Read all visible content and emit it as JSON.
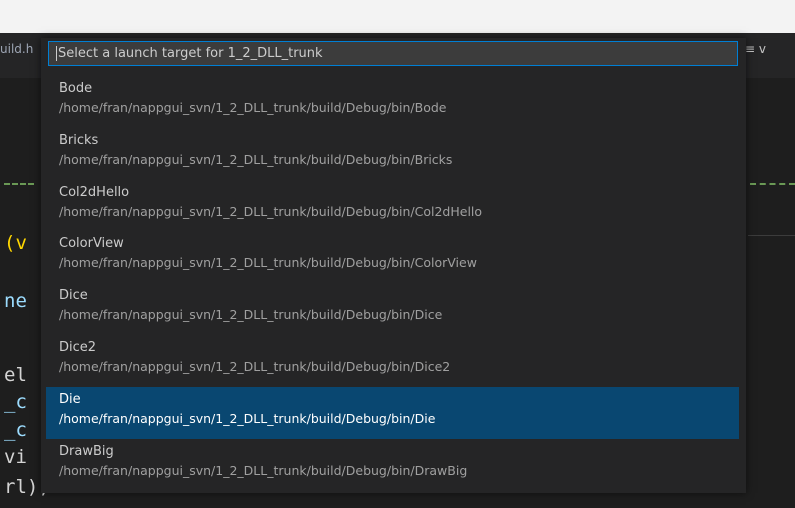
{
  "tabs": {
    "left_fragment": "uild.h",
    "right_fragment": "≡ v"
  },
  "code_fragments": [
    "(v",
    "ne",
    "el",
    "_c",
    "_c",
    "vi",
    "rl);"
  ],
  "quick_pick": {
    "placeholder": "Select a launch target for 1_2_DLL_trunk",
    "items": [
      {
        "label": "Bode",
        "description": "/home/fran/nappgui_svn/1_2_DLL_trunk/build/Debug/bin/Bode"
      },
      {
        "label": "Bricks",
        "description": "/home/fran/nappgui_svn/1_2_DLL_trunk/build/Debug/bin/Bricks"
      },
      {
        "label": "Col2dHello",
        "description": "/home/fran/nappgui_svn/1_2_DLL_trunk/build/Debug/bin/Col2dHello"
      },
      {
        "label": "ColorView",
        "description": "/home/fran/nappgui_svn/1_2_DLL_trunk/build/Debug/bin/ColorView"
      },
      {
        "label": "Dice",
        "description": "/home/fran/nappgui_svn/1_2_DLL_trunk/build/Debug/bin/Dice"
      },
      {
        "label": "Dice2",
        "description": "/home/fran/nappgui_svn/1_2_DLL_trunk/build/Debug/bin/Dice2"
      },
      {
        "label": "Die",
        "description": "/home/fran/nappgui_svn/1_2_DLL_trunk/build/Debug/bin/Die",
        "selected": true
      },
      {
        "label": "DrawBig",
        "description": "/home/fran/nappgui_svn/1_2_DLL_trunk/build/Debug/bin/DrawBig"
      }
    ]
  }
}
